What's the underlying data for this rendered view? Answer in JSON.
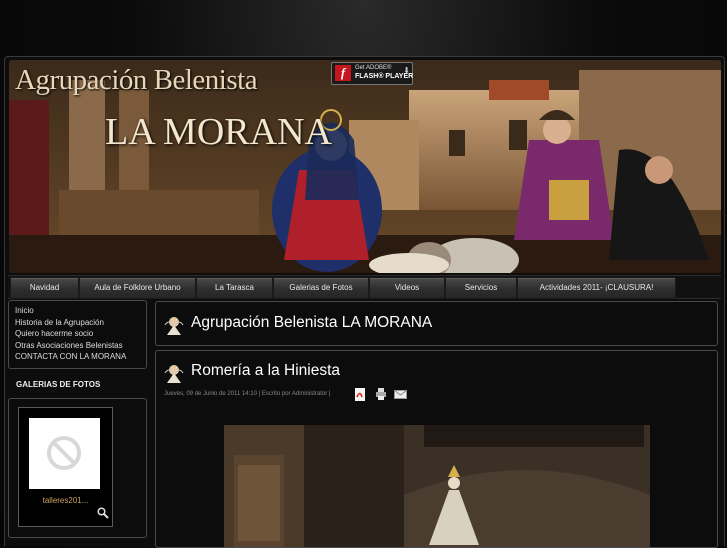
{
  "banner": {
    "title_line1": "Agrupación Belenista",
    "title_line2": "LA MORANA",
    "flash_badge": {
      "line1": "Get ADOBE®",
      "line2": "FLASH® PLAYER"
    }
  },
  "nav": {
    "items": [
      "Navidad",
      "Aula de Folklore Urbano",
      "La Tarasca",
      "Galerias de Fotos",
      "Videos",
      "Servicios",
      "Actividades 2011- ¡CLAUSURA!"
    ]
  },
  "sidebar": {
    "menu": [
      "Inicio",
      "Historia de la Agrupación",
      "Quiero hacerme socio",
      "Otras Asociaciones Belenistas",
      "CONTACTA CON LA MORANA"
    ],
    "gallery_heading": "GALERIAS DE FOTOS",
    "gallery_caption": "talleres201..."
  },
  "content": {
    "page_title": "Agrupación Belenista LA MORANA",
    "article_title": "Romería a la Hiniesta",
    "meta": "Jueves, 09 de Junio de 2011 14:10 | Escrito por Administrator |"
  },
  "colors": {
    "background": "#0b0b0b",
    "panel_border": "#4a4a4a",
    "accent_caption": "#d0a060",
    "flash_red": "#c4161c"
  }
}
